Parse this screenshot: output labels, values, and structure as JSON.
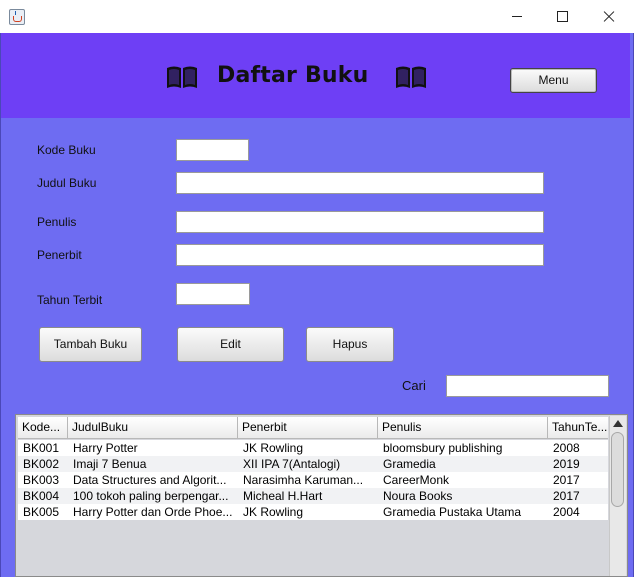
{
  "window": {
    "icon": "java-icon",
    "controls": [
      "minimize-icon",
      "maximize-icon",
      "close-icon"
    ]
  },
  "header": {
    "title": "Daftar Buku",
    "icon": "book-icon",
    "menu_label": "Menu",
    "bg_color": "#6e3ff5"
  },
  "form": {
    "kode_label": "Kode Buku",
    "judul_label": "Judul Buku",
    "penulis_label": "Penulis",
    "penerbit_label": "Penerbit",
    "tahun_label": "Tahun Terbit",
    "kode_value": "",
    "judul_value": "",
    "penulis_value": "",
    "penerbit_value": "",
    "tahun_value": ""
  },
  "actions": {
    "tambah": "Tambah Buku",
    "edit": "Edit",
    "hapus": "Hapus"
  },
  "search": {
    "label": "Cari",
    "value": ""
  },
  "table": {
    "columns": [
      "Kode...",
      "JudulBuku",
      "Penerbit",
      "Penulis",
      "TahunTe..."
    ],
    "rows": [
      [
        "BK001",
        "Harry Potter",
        "JK Rowling",
        "bloomsbury publishing",
        "2008"
      ],
      [
        "BK002",
        "Imaji 7 Benua",
        "XII IPA 7(Antalogi)",
        "Gramedia",
        "2019"
      ],
      [
        "BK003",
        "Data Structures and Algorit...",
        "Narasimha Karuman...",
        "CareerMonk",
        "2017"
      ],
      [
        "BK004",
        "100 tokoh paling berpengar...",
        "Micheal H.Hart",
        "Noura Books",
        "2017"
      ],
      [
        "BK005",
        "Harry Potter dan Orde Phoe...",
        "JK Rowling",
        "Gramedia Pustaka Utama",
        "2004"
      ]
    ]
  },
  "colors": {
    "panel": "#6e6cf2",
    "header": "#6e3ff5"
  }
}
